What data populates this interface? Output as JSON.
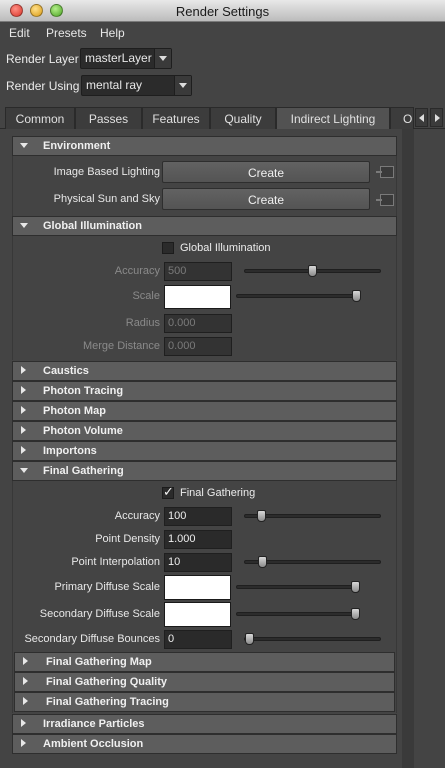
{
  "window": {
    "title": "Render Settings"
  },
  "menu": [
    "Edit",
    "Presets",
    "Help"
  ],
  "render_layer": {
    "label": "Render Layer",
    "value": "masterLayer"
  },
  "render_using": {
    "label": "Render Using",
    "value": "mental ray"
  },
  "tabs": [
    "Common",
    "Passes",
    "Features",
    "Quality",
    "Indirect Lighting",
    "O"
  ],
  "active_tab": "Indirect Lighting",
  "environment": {
    "header": "Environment",
    "ibl_label": "Image Based Lighting",
    "ibl_button": "Create",
    "sun_label": "Physical Sun and Sky",
    "sun_button": "Create"
  },
  "global_illumination": {
    "header": "Global Illumination",
    "checkbox_label": "Global Illumination",
    "enabled": false,
    "accuracy_label": "Accuracy",
    "accuracy": "500",
    "scale_label": "Scale",
    "radius_label": "Radius",
    "radius": "0.000",
    "merge_label": "Merge Distance",
    "merge": "0.000"
  },
  "collapsed_sections": [
    "Caustics",
    "Photon Tracing",
    "Photon Map",
    "Photon Volume",
    "Importons"
  ],
  "final_gathering": {
    "header": "Final Gathering",
    "checkbox_label": "Final Gathering",
    "enabled": true,
    "accuracy_label": "Accuracy",
    "accuracy": "100",
    "point_density_label": "Point Density",
    "point_density": "1.000",
    "point_interp_label": "Point Interpolation",
    "point_interp": "10",
    "primary_diffuse_label": "Primary Diffuse Scale",
    "secondary_diffuse_label": "Secondary Diffuse Scale",
    "secondary_bounces_label": "Secondary Diffuse Bounces",
    "secondary_bounces": "0",
    "subsections": [
      "Final Gathering Map",
      "Final Gathering Quality",
      "Final Gathering Tracing"
    ]
  },
  "bottom_sections": [
    "Irradiance Particles",
    "Ambient Occlusion"
  ],
  "colors": {
    "panel": "#444444",
    "header": "#5d5d5d",
    "field": "#2a2a2a",
    "swatch": "#ffffff"
  }
}
